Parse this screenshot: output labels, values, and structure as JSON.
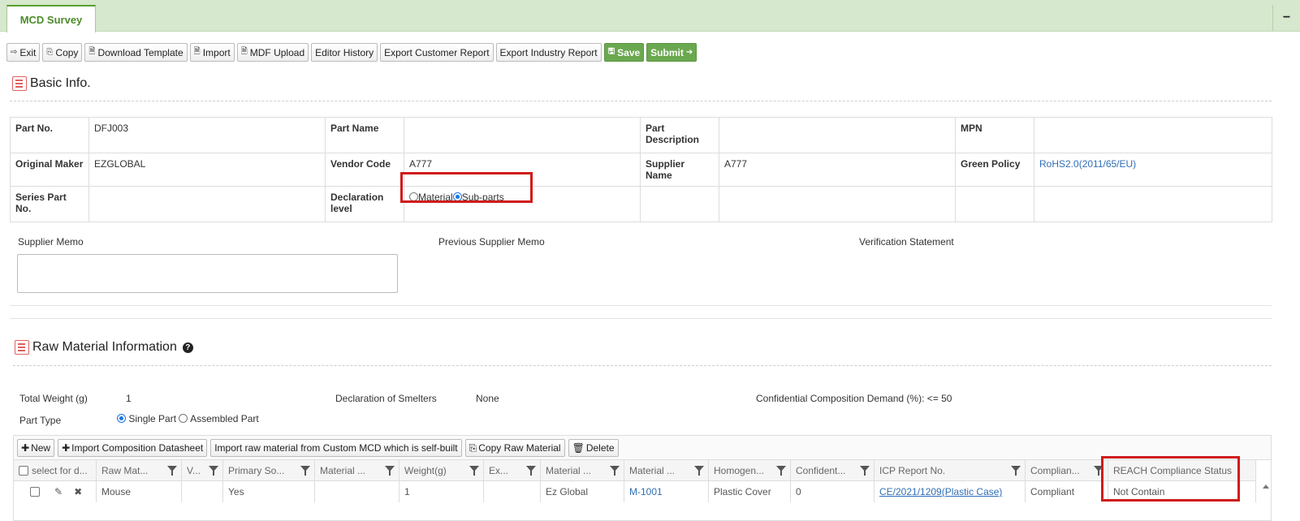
{
  "tab": {
    "title": "MCD Survey",
    "minimize_glyph": "−"
  },
  "toolbar": {
    "exit": "Exit",
    "copy": "Copy",
    "download_template": "Download Template",
    "import": "Import",
    "mdf_upload": "MDF Upload",
    "editor_history": "Editor History",
    "export_customer_report": "Export Customer Report",
    "export_industry_report": "Export Industry Report",
    "save": "Save",
    "submit": "Submit"
  },
  "basic_info": {
    "title": "Basic Info.",
    "part_no_label": "Part No.",
    "part_no": "DFJ003",
    "part_name_label": "Part Name",
    "part_name": "",
    "part_description_label": "Part Description",
    "part_description": "",
    "mpn_label": "MPN",
    "mpn": "",
    "original_maker_label": "Original Maker",
    "original_maker": "EZGLOBAL",
    "vendor_code_label": "Vendor Code",
    "vendor_code": "A777",
    "supplier_name_label": "Supplier Name",
    "supplier_name": "A777",
    "green_policy_label": "Green Policy",
    "green_policy": "RoHS2.0(2011/65/EU)",
    "series_part_no_label": "Series Part No.",
    "series_part_no": "",
    "declaration_level_label": "Declaration level",
    "declaration_options": [
      "Material",
      "Sub-parts"
    ],
    "declaration_selected": "Sub-parts"
  },
  "memo": {
    "supplier_memo_label": "Supplier Memo",
    "supplier_memo_value": "",
    "previous_supplier_memo_label": "Previous Supplier Memo",
    "verification_statement_label": "Verification Statement"
  },
  "raw_material": {
    "title": "Raw Material Information",
    "total_weight_label": "Total Weight (g)",
    "total_weight": "1",
    "smelters_label": "Declaration of Smelters",
    "smelters": "None",
    "confidential_demand": "Confidential Composition Demand (%): <= 50",
    "part_type_label": "Part Type",
    "part_type_options": [
      "Single Part",
      "Assembled Part"
    ],
    "part_type_selected": "Single Part",
    "grid_toolbar": {
      "new": "New",
      "import_composition": "Import Composition Datasheet",
      "import_custom": "Import raw material from Custom MCD which is self-built",
      "copy_raw": "Copy Raw Material",
      "delete": "Delete"
    },
    "columns": [
      "select for d...",
      "Raw Mat...",
      "V...",
      "Primary So...",
      "Material ...",
      "Weight(g)",
      "Ex...",
      "Material ...",
      "Material ...",
      "Homogen...",
      "Confident...",
      "ICP Report No.",
      "Complian...",
      "REACH Compliance Status"
    ],
    "rows": [
      {
        "raw_material": "Mouse",
        "v": "",
        "primary_source": "Yes",
        "material_1": "",
        "weight": "1",
        "ex": "",
        "material_2": "Ez Global",
        "material_3": "M-1001",
        "homogeneous": "Plastic Cover",
        "confidential": "0",
        "icp_report": "CE/2021/1209(Plastic Case)",
        "compliance": "Compliant",
        "reach_status": "Not Contain"
      }
    ]
  },
  "colors": {
    "tab_bar": "#d6e8cd",
    "accent_green": "#6aa84f",
    "highlight_red": "#d01c1c",
    "link_blue": "#2f6fb6"
  }
}
